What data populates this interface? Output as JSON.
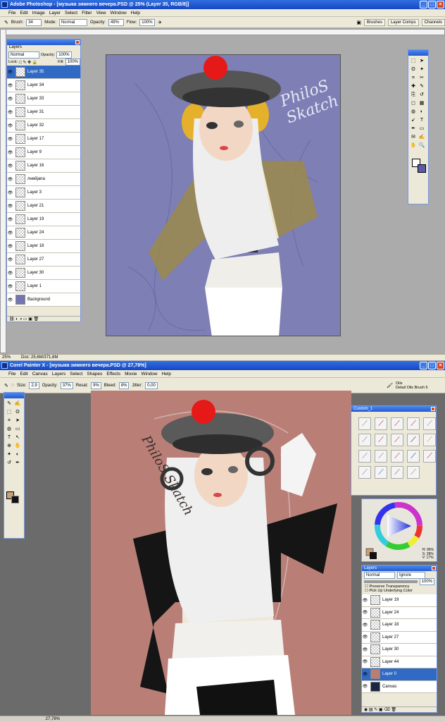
{
  "photoshop": {
    "title": "Adobe Photoshop - [музыка зимнего вечера.PSD @ 25% (Layer 35, RGB/8)]",
    "menu": [
      "File",
      "Edit",
      "Image",
      "Layer",
      "Select",
      "Filter",
      "View",
      "Window",
      "Help"
    ],
    "options": {
      "brush_label": "Brush:",
      "brush_size": "34",
      "mode_label": "Mode:",
      "mode_value": "Normal",
      "opacity_label": "Opacity:",
      "opacity_value": "49%",
      "flow_label": "Flow:",
      "flow_value": "100%"
    },
    "palette_tabs": [
      "Brushes",
      "Layer Comps",
      "Channels"
    ],
    "layers_panel": {
      "tab": "Layers",
      "blend_mode": "Normal",
      "opacity_label": "Opacity:",
      "opacity_value": "100%",
      "lock_label": "Lock:",
      "fill_label": "Fill:",
      "fill_value": "100%",
      "layers": [
        "Layer 35",
        "Layer 34",
        "Layer 33",
        "Layer 31",
        "Layer 32",
        "Layer 17",
        "Layer 9",
        "Layer 16",
        "лнейjana",
        "Layer 3",
        "Layer 21",
        "Layer 19",
        "Layer 24",
        "Layer 18",
        "Layer 27",
        "Layer 30",
        "Layer 1",
        "Background"
      ]
    },
    "status": {
      "zoom": "25%",
      "doc": "Doc: 25,6M/371,6M"
    },
    "canvas_color": "#7d7fb5"
  },
  "painter": {
    "title": "Corel Painter X - [музыка зимнего вечера.PSD @ 27,78%]",
    "menu": [
      "File",
      "Edit",
      "Canvas",
      "Layers",
      "Select",
      "Shapes",
      "Effects",
      "Movie",
      "Window",
      "Help"
    ],
    "options": {
      "size_label": "Size:",
      "size_value": "2,9",
      "opacity_label": "Opacity:",
      "opacity_value": "37%",
      "resat_label": "Resat:",
      "resat_value": "9%",
      "bleed_label": "Bleed:",
      "bleed_value": "8%",
      "jitter_label": "Jitter:",
      "jitter_value": "0,00"
    },
    "brush_category": "Oils",
    "brush_variant": "Detail Oils Brush 5",
    "custom_palette_title": "Custom_1",
    "color_readout": {
      "h": "H: 96%",
      "s": "S: 28%",
      "v": "V: 17%"
    },
    "layers_panel": {
      "tab": "Layers",
      "composite": "Normal",
      "method": "Ignore",
      "opacity_value": "100%",
      "preserve_label": "Preserve Transparency",
      "pickup_label": "Pick Up Underlying Color",
      "layers": [
        "Layer 19",
        "Layer 24",
        "Layer 18",
        "Layer 27",
        "Layer 30",
        "Layer 44",
        "Layer 0",
        "Canvas"
      ]
    },
    "status": {
      "zoom": "27,78%"
    },
    "canvas_color": "#b97f77"
  },
  "signature_text": "PhiloS Skatch"
}
